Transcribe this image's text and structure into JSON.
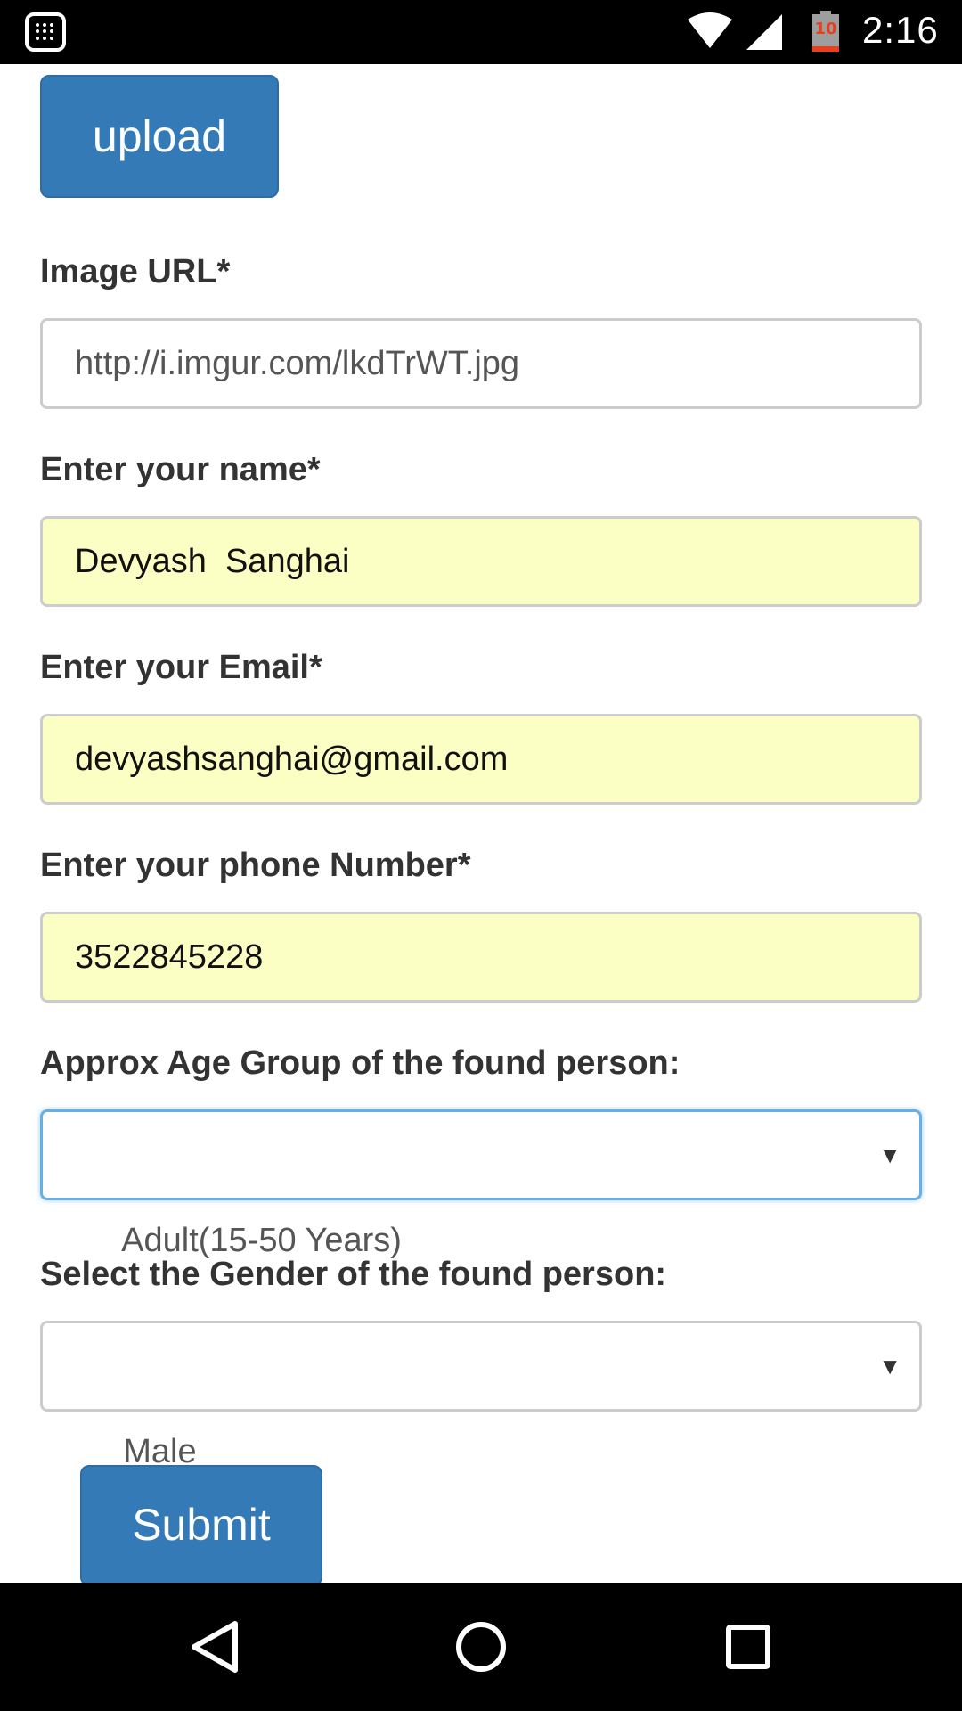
{
  "status_bar": {
    "time": "2:16",
    "battery_level": "10",
    "icons": [
      "app-grid-icon",
      "wifi-icon",
      "cell-signal-icon",
      "battery-icon"
    ]
  },
  "form": {
    "upload_label": "upload",
    "image_url": {
      "label": "Image URL*",
      "placeholder": "http://i.imgur.com/lkdTrWT.jpg"
    },
    "name": {
      "label": "Enter your name*",
      "value": "Devyash  Sanghai"
    },
    "email": {
      "label": "Enter your Email*",
      "value": "devyashsanghai@gmail.com"
    },
    "phone": {
      "label": "Enter your phone Number*",
      "value": "3522845228"
    },
    "age_group": {
      "label": "Approx Age Group of the found person:",
      "selected": "Adult(15-50 Years)"
    },
    "gender": {
      "label": "Select the Gender of the found person:",
      "selected": "Male"
    },
    "submit_label": "Submit"
  },
  "nav_bar": {
    "icons": [
      "back-icon",
      "home-icon",
      "recents-icon"
    ]
  },
  "colors": {
    "primary_button": "#337ab7",
    "autofill_background": "#fbffc4",
    "focus_border": "#66afe9",
    "battery_low": "#e8401c"
  }
}
